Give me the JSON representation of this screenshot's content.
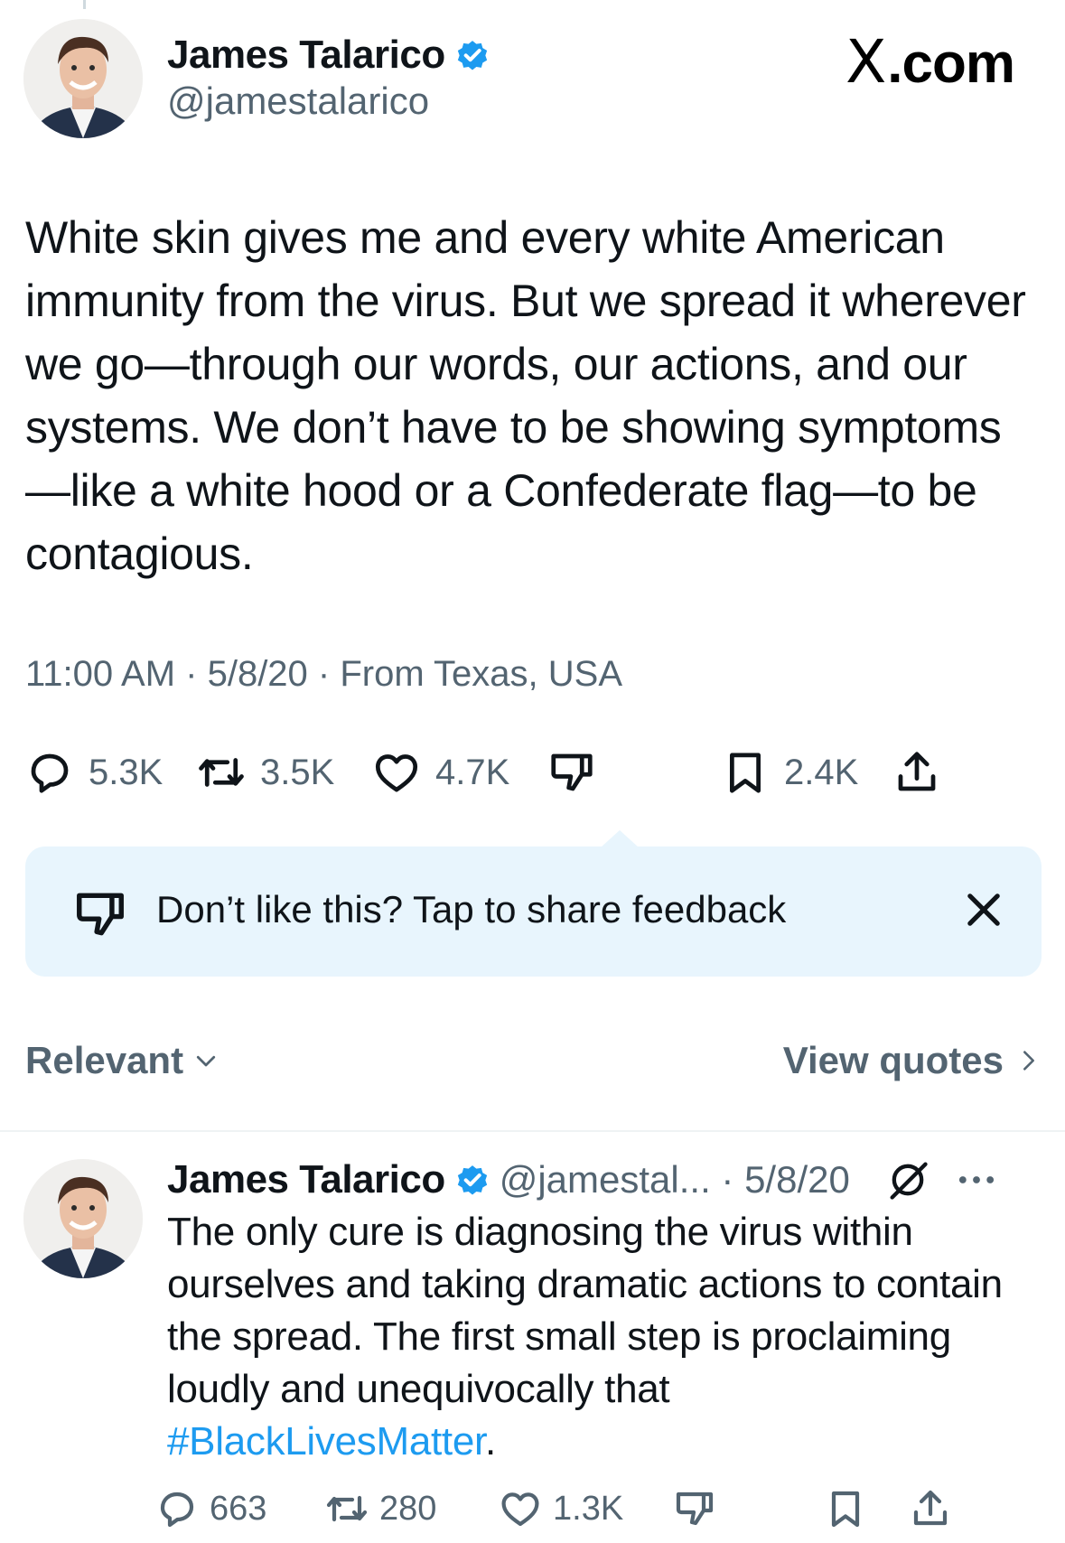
{
  "brand": {
    "text": ".com",
    "logo": "X"
  },
  "tweet": {
    "author_name": "James Talarico",
    "author_handle": "@jamestalarico",
    "text": "White skin gives me and every white American immunity from the virus. But we spread it wherever we go—through our words, our actions, and our systems. We don’t have to be showing symptoms—like a white hood or a Confederate flag—to be contagious.",
    "meta": "11:00 AM · 5/8/20 · From Texas, USA",
    "replies": "5.3K",
    "reposts": "3.5K",
    "likes": "4.7K",
    "bookmarks": "2.4K"
  },
  "feedback": {
    "text": "Don’t like this? Tap to share feedback"
  },
  "sort": {
    "label": "Relevant",
    "view_quotes": "View quotes"
  },
  "reply": {
    "author_name": "James Talarico",
    "handle_date": "@jamestal... · 5/8/20",
    "text_before": "The only cure is diagnosing the virus within ourselves and taking dramatic actions to contain the spread. The first small step is proclaiming loudly and unequivocally that ",
    "hashtag": "#BlackLivesMatter",
    "text_after": ".",
    "replies": "663",
    "reposts": "280",
    "likes": "1.3K"
  },
  "colors": {
    "accent": "#1d9bf0",
    "muted": "#536471",
    "text": "#0f1419",
    "feedback_bg": "#e8f5fd"
  },
  "icons": [
    "verified-badge-icon",
    "reply-icon",
    "repost-icon",
    "like-icon",
    "dislike-icon",
    "bookmark-icon",
    "share-icon",
    "close-icon",
    "chevron-down-icon",
    "chevron-right-icon",
    "grok-icon",
    "more-icon"
  ]
}
